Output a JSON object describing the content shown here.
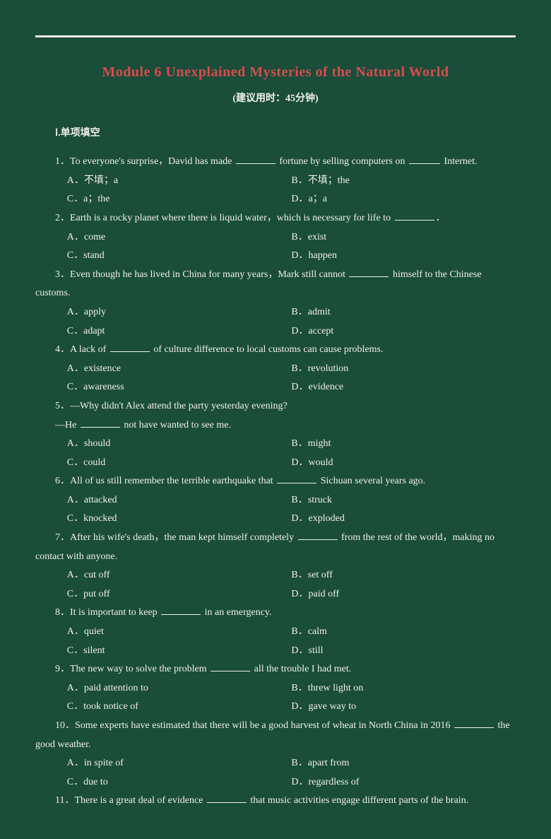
{
  "title": "Module 6  Unexplained Mysteries of the Natural World",
  "subtitle": "(建议用时：45分钟)",
  "section1": "Ⅰ.单项填空",
  "q1": {
    "stem_a": "1．To everyone's surprise，David has made ",
    "stem_b": " fortune by selling computers on ",
    "stem_c": " Internet.",
    "A": "A．不填；a",
    "B": "B．不填；the",
    "C": "C．a；the",
    "D": "D．a；a"
  },
  "q2": {
    "stem_a": "2．Earth is a rocky planet where there is liquid water，which is necessary for life to ",
    "stem_b": "．",
    "A": "A．come",
    "B": "B．exist",
    "C": "C．stand",
    "D": "D．happen"
  },
  "q3": {
    "stem_a": "3．Even though he has lived in China for many years，Mark still cannot ",
    "stem_b": " himself to the Chinese customs.",
    "A": "A．apply",
    "B": "B．admit",
    "C": "C．adapt",
    "D": "D．accept"
  },
  "q4": {
    "stem_a": "4．A lack of ",
    "stem_b": " of culture difference to local customs can cause problems.",
    "A": "A．existence",
    "B": "B．revolution",
    "C": "C．awareness",
    "D": "D．evidence"
  },
  "q5": {
    "line1": "5．—Why didn't Alex attend the party yesterday evening?",
    "line2_a": "—He ",
    "line2_b": " not have wanted to see me.",
    "A": "A．should",
    "B": "B．might",
    "C": "C．could",
    "D": "D．would"
  },
  "q6": {
    "stem_a": "6．All of us still remember the terrible earthquake that ",
    "stem_b": " Sichuan several years ago.",
    "A": "A．attacked",
    "B": "B．struck",
    "C": "C．knocked",
    "D": "D．exploded"
  },
  "q7": {
    "stem_a": "7．After his wife's death，the man kept himself completely ",
    "stem_b": " from the rest of the world，making no contact with anyone.",
    "A": "A．cut off",
    "B": "B．set off",
    "C": "C．put off",
    "D": "D．paid off"
  },
  "q8": {
    "stem_a": "8．It is important to keep ",
    "stem_b": " in an emergency.",
    "A": "A．quiet",
    "B": "B．calm",
    "C": "C．silent",
    "D": "D．still"
  },
  "q9": {
    "stem_a": "9．The new way to solve the problem ",
    "stem_b": " all the trouble I had met.",
    "A": "A．paid attention to",
    "B": "B．threw light on",
    "C": "C．took notice of",
    "D": "D．gave way to"
  },
  "q10": {
    "stem_a": "10．Some experts have estimated that there will be a good harvest of wheat in North China in 2016 ",
    "stem_b": " the good weather.",
    "A": "A．in spite of",
    "B": "B．apart from",
    "C": "C．due to",
    "D": "D．regardless of"
  },
  "q11": {
    "stem_a": "11．There is a great deal of evidence ",
    "stem_b": " that music activities engage different parts of the brain."
  }
}
